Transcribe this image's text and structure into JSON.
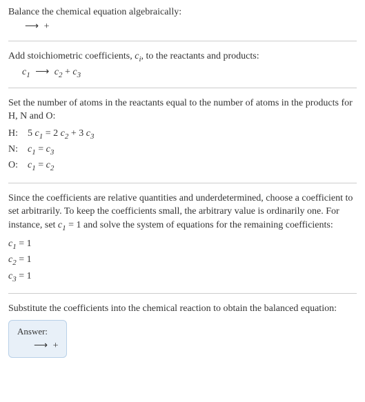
{
  "section1": {
    "text": "Balance the chemical equation algebraically:",
    "equation": {
      "arrow": "⟶",
      "plus": "+"
    }
  },
  "section2": {
    "text_prefix": "Add stoichiometric coefficients, ",
    "coeff_var": "c",
    "coeff_sub": "i",
    "text_suffix": ", to the reactants and products:",
    "eq": {
      "c1": "c",
      "c1_sub": "1",
      "arrow": "⟶",
      "c2": "c",
      "c2_sub": "2",
      "plus": "+",
      "c3": "c",
      "c3_sub": "3"
    }
  },
  "section3": {
    "text": "Set the number of atoms in the reactants equal to the number of atoms in the products for H, N and O:",
    "rows": [
      {
        "label": "H:",
        "lhs_coef": "5 ",
        "lhs_var": "c",
        "lhs_sub": "1",
        "eq": " = 2 ",
        "r1_var": "c",
        "r1_sub": "2",
        "mid": " + 3 ",
        "r2_var": "c",
        "r2_sub": "3"
      },
      {
        "label": "N:",
        "lhs_coef": "",
        "lhs_var": "c",
        "lhs_sub": "1",
        "eq": " = ",
        "r1_var": "c",
        "r1_sub": "3",
        "mid": "",
        "r2_var": "",
        "r2_sub": ""
      },
      {
        "label": "O:",
        "lhs_coef": "",
        "lhs_var": "c",
        "lhs_sub": "1",
        "eq": " = ",
        "r1_var": "c",
        "r1_sub": "2",
        "mid": "",
        "r2_var": "",
        "r2_sub": ""
      }
    ]
  },
  "section4": {
    "text_p1": "Since the coefficients are relative quantities and underdetermined, choose a coefficient to set arbitrarily. To keep the coefficients small, the arbitrary value is ordinarily one. For instance, set ",
    "var": "c",
    "var_sub": "1",
    "text_p2": " = 1 and solve the system of equations for the remaining coefficients:",
    "coeffs": [
      {
        "var": "c",
        "sub": "1",
        "val": " = 1"
      },
      {
        "var": "c",
        "sub": "2",
        "val": " = 1"
      },
      {
        "var": "c",
        "sub": "3",
        "val": " = 1"
      }
    ]
  },
  "section5": {
    "text": "Substitute the coefficients into the chemical reaction to obtain the balanced equation:",
    "answer_label": "Answer:",
    "answer_eq": {
      "arrow": "⟶",
      "plus": "+"
    }
  }
}
